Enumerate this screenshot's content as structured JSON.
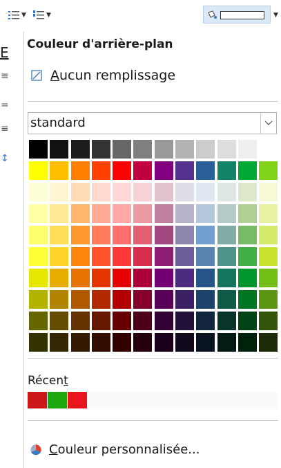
{
  "popup": {
    "title": "Couleur d'arrière-plan",
    "no_fill_label": "Aucun remplissage",
    "palette_select_value": "standard",
    "recent_label": "Récent",
    "custom_color_label": "Couleur personnalisée..."
  },
  "sidebar": {
    "letter": "E"
  },
  "palette": {
    "rows": [
      [
        "#000000",
        "#111111",
        "#1c1c1c",
        "#333333",
        "#666666",
        "#808080",
        "#999999",
        "#b2b2b2",
        "#cccccc",
        "#dddddd",
        "#eeeeee",
        "#ffffff"
      ],
      [
        "#ffff00",
        "#ffbf00",
        "#ff8000",
        "#ff4000",
        "#ff0000",
        "#bf0041",
        "#800080",
        "#55308d",
        "#2a6099",
        "#158466",
        "#00a933",
        "#81d41a"
      ],
      [
        "#ffffd7",
        "#fff5ce",
        "#ffdbb6",
        "#ffd8ce",
        "#ffd7d7",
        "#f7d1d5",
        "#e0c2cd",
        "#dedce6",
        "#dee6ef",
        "#dee7e5",
        "#dde8cb",
        "#f6f9d4"
      ],
      [
        "#ffffa6",
        "#ffe994",
        "#ffb66c",
        "#ffaa95",
        "#ffa6a6",
        "#ec9ba4",
        "#bf819e",
        "#b7b3ca",
        "#b4c7dc",
        "#b3cac7",
        "#afd095",
        "#e8f2a1"
      ],
      [
        "#ffff6d",
        "#ffde59",
        "#ff972f",
        "#ff7b59",
        "#ff6d6d",
        "#e16173",
        "#a1467e",
        "#8e86ae",
        "#729fcf",
        "#81aca6",
        "#77bc65",
        "#d4ea6b"
      ],
      [
        "#ffff38",
        "#ffd428",
        "#ff860d",
        "#ff5429",
        "#ff3838",
        "#d62e4e",
        "#8d1d75",
        "#6b5e9b",
        "#5983b0",
        "#50938a",
        "#3faf46",
        "#c9e32f"
      ],
      [
        "#e6e600",
        "#e6ac00",
        "#e67300",
        "#e63600",
        "#e60000",
        "#ac0039",
        "#730073",
        "#4c2b80",
        "#265689",
        "#13765c",
        "#00982e",
        "#73bf17"
      ],
      [
        "#b2b200",
        "#b28500",
        "#b25900",
        "#b22a00",
        "#b20000",
        "#85002c",
        "#590059",
        "#3b2163",
        "#1e436b",
        "#0f5b47",
        "#007623",
        "#5a9612"
      ],
      [
        "#666600",
        "#664c00",
        "#663300",
        "#661800",
        "#660000",
        "#4c0019",
        "#330033",
        "#221239",
        "#11263d",
        "#093429",
        "#004314",
        "#33560a"
      ],
      [
        "#333300",
        "#332600",
        "#331a00",
        "#330c00",
        "#330000",
        "#26000c",
        "#1a001a",
        "#11091c",
        "#08131f",
        "#041a14",
        "#00220a",
        "#1a2b05"
      ]
    ],
    "recent": [
      "#cc1818",
      "#1ea80f",
      "#e8141e"
    ]
  },
  "icons": {
    "no_fill": "no-fill-icon",
    "custom_color": "color-wheel-icon",
    "chevron": "chevron-down-icon"
  }
}
